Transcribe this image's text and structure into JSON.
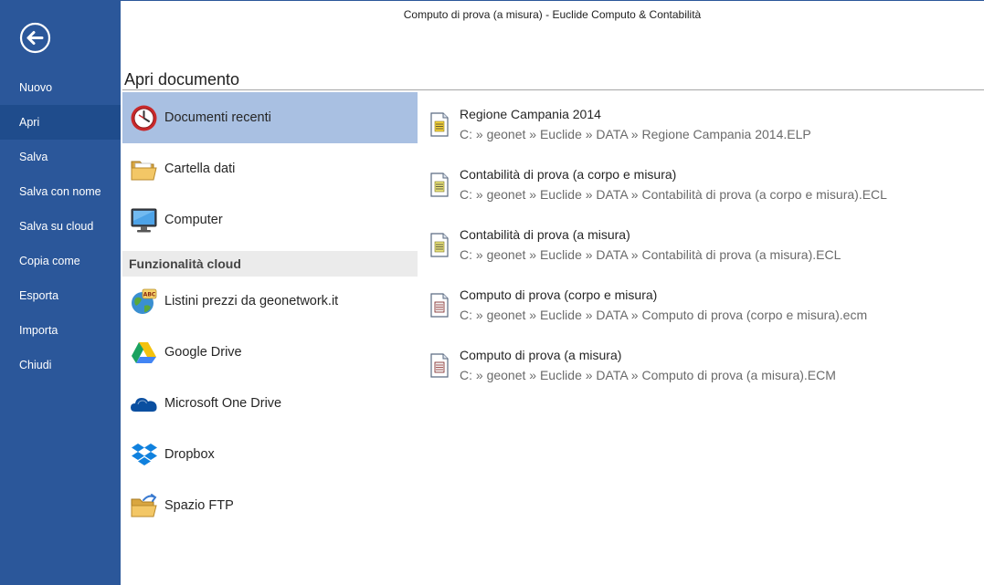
{
  "window": {
    "title": "Computo di prova (a misura) - Euclide Computo & Contabilità"
  },
  "sidebar": {
    "back_icon": "back-arrow-icon",
    "items": [
      {
        "label": "Nuovo"
      },
      {
        "label": "Apri",
        "active": true
      },
      {
        "label": "Salva"
      },
      {
        "label": "Salva con nome"
      },
      {
        "label": "Salva su cloud"
      },
      {
        "label": "Copia come"
      },
      {
        "label": "Esporta"
      },
      {
        "label": "Importa"
      },
      {
        "label": "Chiudi"
      }
    ]
  },
  "page": {
    "title": "Apri documento"
  },
  "locations": {
    "recent": {
      "label": "Documenti recenti",
      "icon": "clock-icon",
      "selected": true
    },
    "data_folder": {
      "label": "Cartella dati",
      "icon": "folder-icon"
    },
    "computer": {
      "label": "Computer",
      "icon": "monitor-icon"
    },
    "cloud_header": "Funzionalità cloud",
    "cloud": [
      {
        "label": "Listini prezzi da geonetwork.it",
        "icon": "globe-icon"
      },
      {
        "label": "Google Drive",
        "icon": "google-drive-icon"
      },
      {
        "label": "Microsoft One Drive",
        "icon": "onedrive-icon"
      },
      {
        "label": "Dropbox",
        "icon": "dropbox-icon"
      },
      {
        "label": "Spazio FTP",
        "icon": "ftp-folder-icon"
      }
    ]
  },
  "recent_documents": [
    {
      "name": "Regione Campania 2014",
      "path": "C: » geonet » Euclide » DATA » Regione Campania 2014.ELP",
      "icon": "price-list-document-icon"
    },
    {
      "name": "Contabilità di prova (a corpo e misura)",
      "path": "C: » geonet » Euclide » DATA » Contabilità di prova (a corpo e misura).ECL",
      "icon": "accounting-document-icon"
    },
    {
      "name": "Contabilità di prova (a misura)",
      "path": "C: » geonet » Euclide » DATA » Contabilità di prova (a misura).ECL",
      "icon": "accounting-document-icon"
    },
    {
      "name": "Computo di prova (corpo e misura)",
      "path": "C: » geonet » Euclide » DATA » Computo di prova (corpo e misura).ecm",
      "icon": "estimate-document-icon"
    },
    {
      "name": "Computo di prova (a misura)",
      "path": "C: » geonet » Euclide » DATA » Computo di prova (a misura).ECM",
      "icon": "estimate-document-icon"
    }
  ],
  "colors": {
    "sidebar": "#2b579a",
    "sidebar_active": "#1f4c8c",
    "selected": "#a9c0e2",
    "section_bg": "#ebebeb"
  }
}
